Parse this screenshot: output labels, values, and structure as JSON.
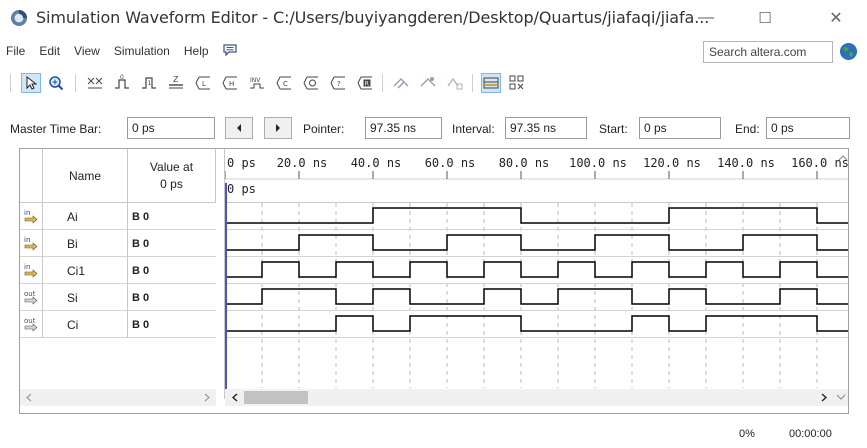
{
  "window": {
    "title": "Simulation Waveform Editor - C:/Users/buyiyangderen/Desktop/Quartus/jiafaqi/jiafa...",
    "minimize_glyph": "—",
    "maximize_glyph": "☐",
    "close_glyph": "✕"
  },
  "menu": {
    "items": [
      "File",
      "Edit",
      "View",
      "Simulation",
      "Help"
    ],
    "search_placeholder": "Search altera.com"
  },
  "controls": {
    "master_label": "Master Time Bar:",
    "master_value": "0 ps",
    "pointer_label": "Pointer:",
    "pointer_value": "97.35 ns",
    "interval_label": "Interval:",
    "interval_value": "97.35 ns",
    "start_label": "Start:",
    "start_value": "0 ps",
    "end_label": "End:",
    "end_value": "0 ps"
  },
  "table": {
    "header_name": "Name",
    "header_value_line1": "Value at",
    "header_value_line2": "0 ps",
    "cursor_label": "0 ps",
    "signals": [
      {
        "dir": "in",
        "name": "Ai",
        "value": "B 0",
        "wave": [
          0,
          0,
          0,
          0,
          1,
          1,
          1,
          1,
          0,
          0,
          0,
          0,
          1,
          1,
          1,
          1,
          0
        ]
      },
      {
        "dir": "in",
        "name": "Bi",
        "value": "B 0",
        "wave": [
          0,
          0,
          1,
          1,
          0,
          0,
          1,
          1,
          0,
          0,
          1,
          1,
          0,
          0,
          1,
          1,
          0
        ]
      },
      {
        "dir": "in",
        "name": "Ci1",
        "value": "B 0",
        "wave": [
          0,
          1,
          0,
          1,
          0,
          1,
          0,
          1,
          0,
          1,
          0,
          1,
          0,
          1,
          0,
          1,
          0
        ]
      },
      {
        "dir": "out",
        "name": "Si",
        "value": "B 0",
        "wave": [
          0,
          1,
          1,
          0,
          1,
          0,
          0,
          1,
          0,
          1,
          1,
          0,
          1,
          0,
          0,
          1,
          0
        ]
      },
      {
        "dir": "out",
        "name": "Ci",
        "value": "B 0",
        "wave": [
          0,
          0,
          0,
          1,
          0,
          1,
          1,
          1,
          0,
          0,
          0,
          1,
          0,
          1,
          1,
          1,
          0
        ]
      }
    ]
  },
  "timeline": {
    "ticks": [
      "0 ps",
      "20.0 ns",
      "40.0 ns",
      "60.0 ns",
      "80.0 ns",
      "100.0 ns",
      "120.0 ns",
      "140.0 ns",
      "160.0 ns"
    ]
  },
  "status": {
    "progress": "0%",
    "elapsed": "00:00:00"
  },
  "colors": {
    "wave": "#000000",
    "cursor": "#4a54c8",
    "grid": "#b8b8b8",
    "selection": "#cfe5f8"
  }
}
